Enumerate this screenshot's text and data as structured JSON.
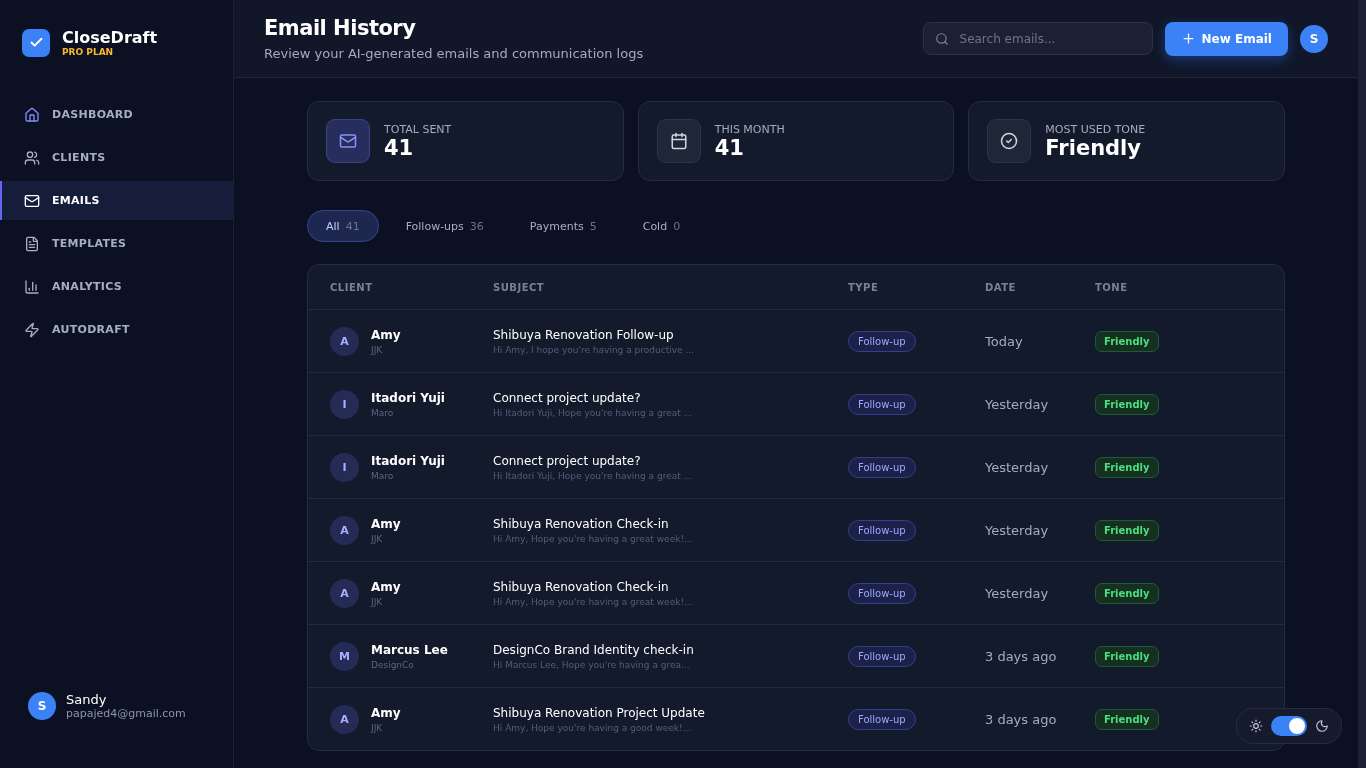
{
  "brand": {
    "name": "CloseDraft",
    "plan": "PRO PLAN"
  },
  "nav": [
    {
      "label": "DASHBOARD",
      "kind": "home",
      "selected": false
    },
    {
      "label": "CLIENTS",
      "kind": "users",
      "selected": false
    },
    {
      "label": "EMAILS",
      "kind": "mail",
      "selected": true
    },
    {
      "label": "TEMPLATES",
      "kind": "file",
      "selected": false
    },
    {
      "label": "ANALYTICS",
      "kind": "chart",
      "selected": false
    },
    {
      "label": "AUTODRAFT",
      "kind": "zap",
      "selected": false
    }
  ],
  "user": {
    "initial": "S",
    "name": "Sandy",
    "email": "papajed4@gmail.com"
  },
  "header": {
    "title": "Email History",
    "subtitle": "Review your AI-generated emails and communication logs",
    "search_placeholder": "Search emails...",
    "new_button": "New Email",
    "avatar": "S"
  },
  "stats": [
    {
      "kind": "mail",
      "label": "TOTAL SENT",
      "value": "41",
      "highlight": true
    },
    {
      "kind": "calendar",
      "label": "THIS MONTH",
      "value": "41",
      "highlight": false
    },
    {
      "kind": "check",
      "label": "MOST USED TONE",
      "value": "Friendly",
      "highlight": false
    }
  ],
  "filters": [
    {
      "label": "All",
      "count": "41",
      "selected": true
    },
    {
      "label": "Follow-ups",
      "count": "36",
      "selected": false
    },
    {
      "label": "Payments",
      "count": "5",
      "selected": false
    },
    {
      "label": "Cold",
      "count": "0",
      "selected": false
    }
  ],
  "table": {
    "columns": [
      "CLIENT",
      "SUBJECT",
      "TYPE",
      "DATE",
      "TONE"
    ],
    "rows": [
      {
        "initial": "A",
        "client": "Amy",
        "company": "JJK",
        "subject": "Shibuya Renovation Follow-up",
        "preview": "Hi Amy, I hope you're having a productive ...",
        "type": "Follow-up",
        "date": "Today",
        "tone": "Friendly"
      },
      {
        "initial": "I",
        "client": "Itadori Yuji",
        "company": "Maro",
        "subject": "Connect project update?",
        "preview": "Hi Itadori Yuji, Hope you're having a great ...",
        "type": "Follow-up",
        "date": "Yesterday",
        "tone": "Friendly"
      },
      {
        "initial": "I",
        "client": "Itadori Yuji",
        "company": "Maro",
        "subject": "Connect project update?",
        "preview": "Hi Itadori Yuji, Hope you're having a great ...",
        "type": "Follow-up",
        "date": "Yesterday",
        "tone": "Friendly"
      },
      {
        "initial": "A",
        "client": "Amy",
        "company": "JJK",
        "subject": "Shibuya Renovation Check-in",
        "preview": "Hi Amy, Hope you're having a great week!...",
        "type": "Follow-up",
        "date": "Yesterday",
        "tone": "Friendly"
      },
      {
        "initial": "A",
        "client": "Amy",
        "company": "JJK",
        "subject": "Shibuya Renovation Check-in",
        "preview": "Hi Amy, Hope you're having a great week!...",
        "type": "Follow-up",
        "date": "Yesterday",
        "tone": "Friendly"
      },
      {
        "initial": "M",
        "client": "Marcus Lee",
        "company": "DesignCo",
        "subject": "DesignCo Brand Identity check-in",
        "preview": "Hi Marcus Lee, Hope you're having a grea...",
        "type": "Follow-up",
        "date": "3 days ago",
        "tone": "Friendly"
      },
      {
        "initial": "A",
        "client": "Amy",
        "company": "JJK",
        "subject": "Shibuya Renovation Project Update",
        "preview": "Hi Amy, Hope you're having a good week!...",
        "type": "Follow-up",
        "date": "3 days ago",
        "tone": "Friendly"
      }
    ]
  },
  "theme_toggle": {
    "dark": true
  }
}
